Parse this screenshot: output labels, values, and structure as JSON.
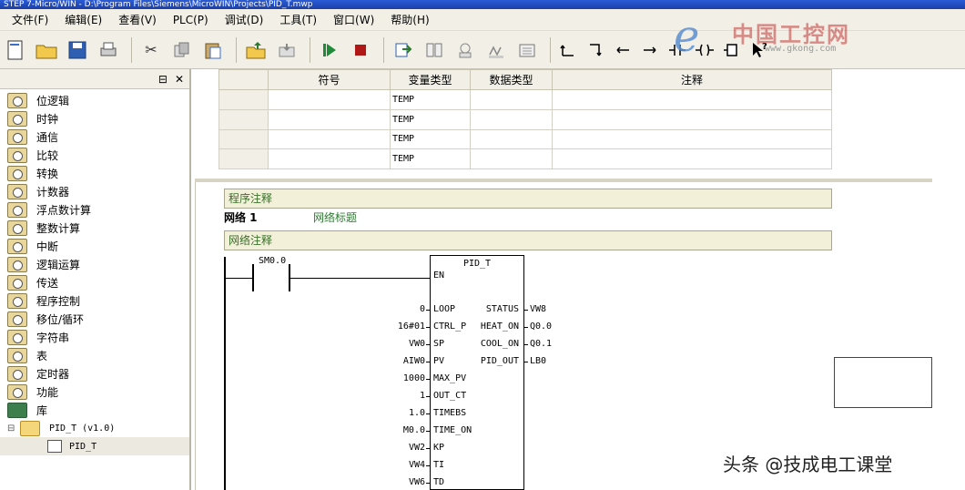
{
  "window": {
    "title": "STEP 7-Micro/WIN - D:\\Program Files\\Siemens\\MicroWIN\\Projects\\PID_T.mwp"
  },
  "menu": [
    "文件(F)",
    "编辑(E)",
    "查看(V)",
    "PLC(P)",
    "调试(D)",
    "工具(T)",
    "窗口(W)",
    "帮助(H)"
  ],
  "logo": {
    "mark": "e",
    "name": "中国工控网",
    "url": "www.gkong.com"
  },
  "left_panel": {
    "header_buttons": [
      "pin",
      "close"
    ],
    "tree": [
      "位逻辑",
      "时钟",
      "通信",
      "比较",
      "转换",
      "计数器",
      "浮点数计算",
      "整数计算",
      "中断",
      "逻辑运算",
      "传送",
      "程序控制",
      "移位/循环",
      "字符串",
      "表",
      "定时器",
      "功能",
      "库"
    ],
    "library": {
      "name": "PID_T (v1.0)",
      "child": "PID_T"
    }
  },
  "var_table": {
    "headers": [
      "",
      "符号",
      "变量类型",
      "数据类型",
      "注释"
    ],
    "rows": [
      [
        "",
        "",
        "TEMP",
        "",
        ""
      ],
      [
        "",
        "",
        "TEMP",
        "",
        ""
      ],
      [
        "",
        "",
        "TEMP",
        "",
        ""
      ],
      [
        "",
        "",
        "TEMP",
        "",
        ""
      ]
    ]
  },
  "program": {
    "program_comment": "程序注释",
    "network_label": "网络 1",
    "network_title": "网络标题",
    "network_comment": "网络注释",
    "contact": "SM0.0",
    "block_name": "PID_T",
    "inputs": [
      {
        "pin": "EN",
        "value": ""
      },
      {
        "pin": "LOOP",
        "value": "0"
      },
      {
        "pin": "CTRL_P",
        "value": "16#01"
      },
      {
        "pin": "SP",
        "value": "VW0"
      },
      {
        "pin": "PV",
        "value": "AIW0"
      },
      {
        "pin": "MAX_PV",
        "value": "1000"
      },
      {
        "pin": "OUT_CT",
        "value": "1"
      },
      {
        "pin": "TIMEBS",
        "value": "1.0"
      },
      {
        "pin": "TIME_ON",
        "value": "M0.0"
      },
      {
        "pin": "KP",
        "value": "VW2"
      },
      {
        "pin": "TI",
        "value": "VW4"
      },
      {
        "pin": "TD",
        "value": "VW6"
      }
    ],
    "outputs": [
      {
        "pin": "STATUS",
        "value": "VW8"
      },
      {
        "pin": "HEAT_ON",
        "value": "Q0.0"
      },
      {
        "pin": "COOL_ON",
        "value": "Q0.1"
      },
      {
        "pin": "PID_OUT",
        "value": "LB0"
      }
    ]
  },
  "credit": "头条 @技成电工课堂"
}
